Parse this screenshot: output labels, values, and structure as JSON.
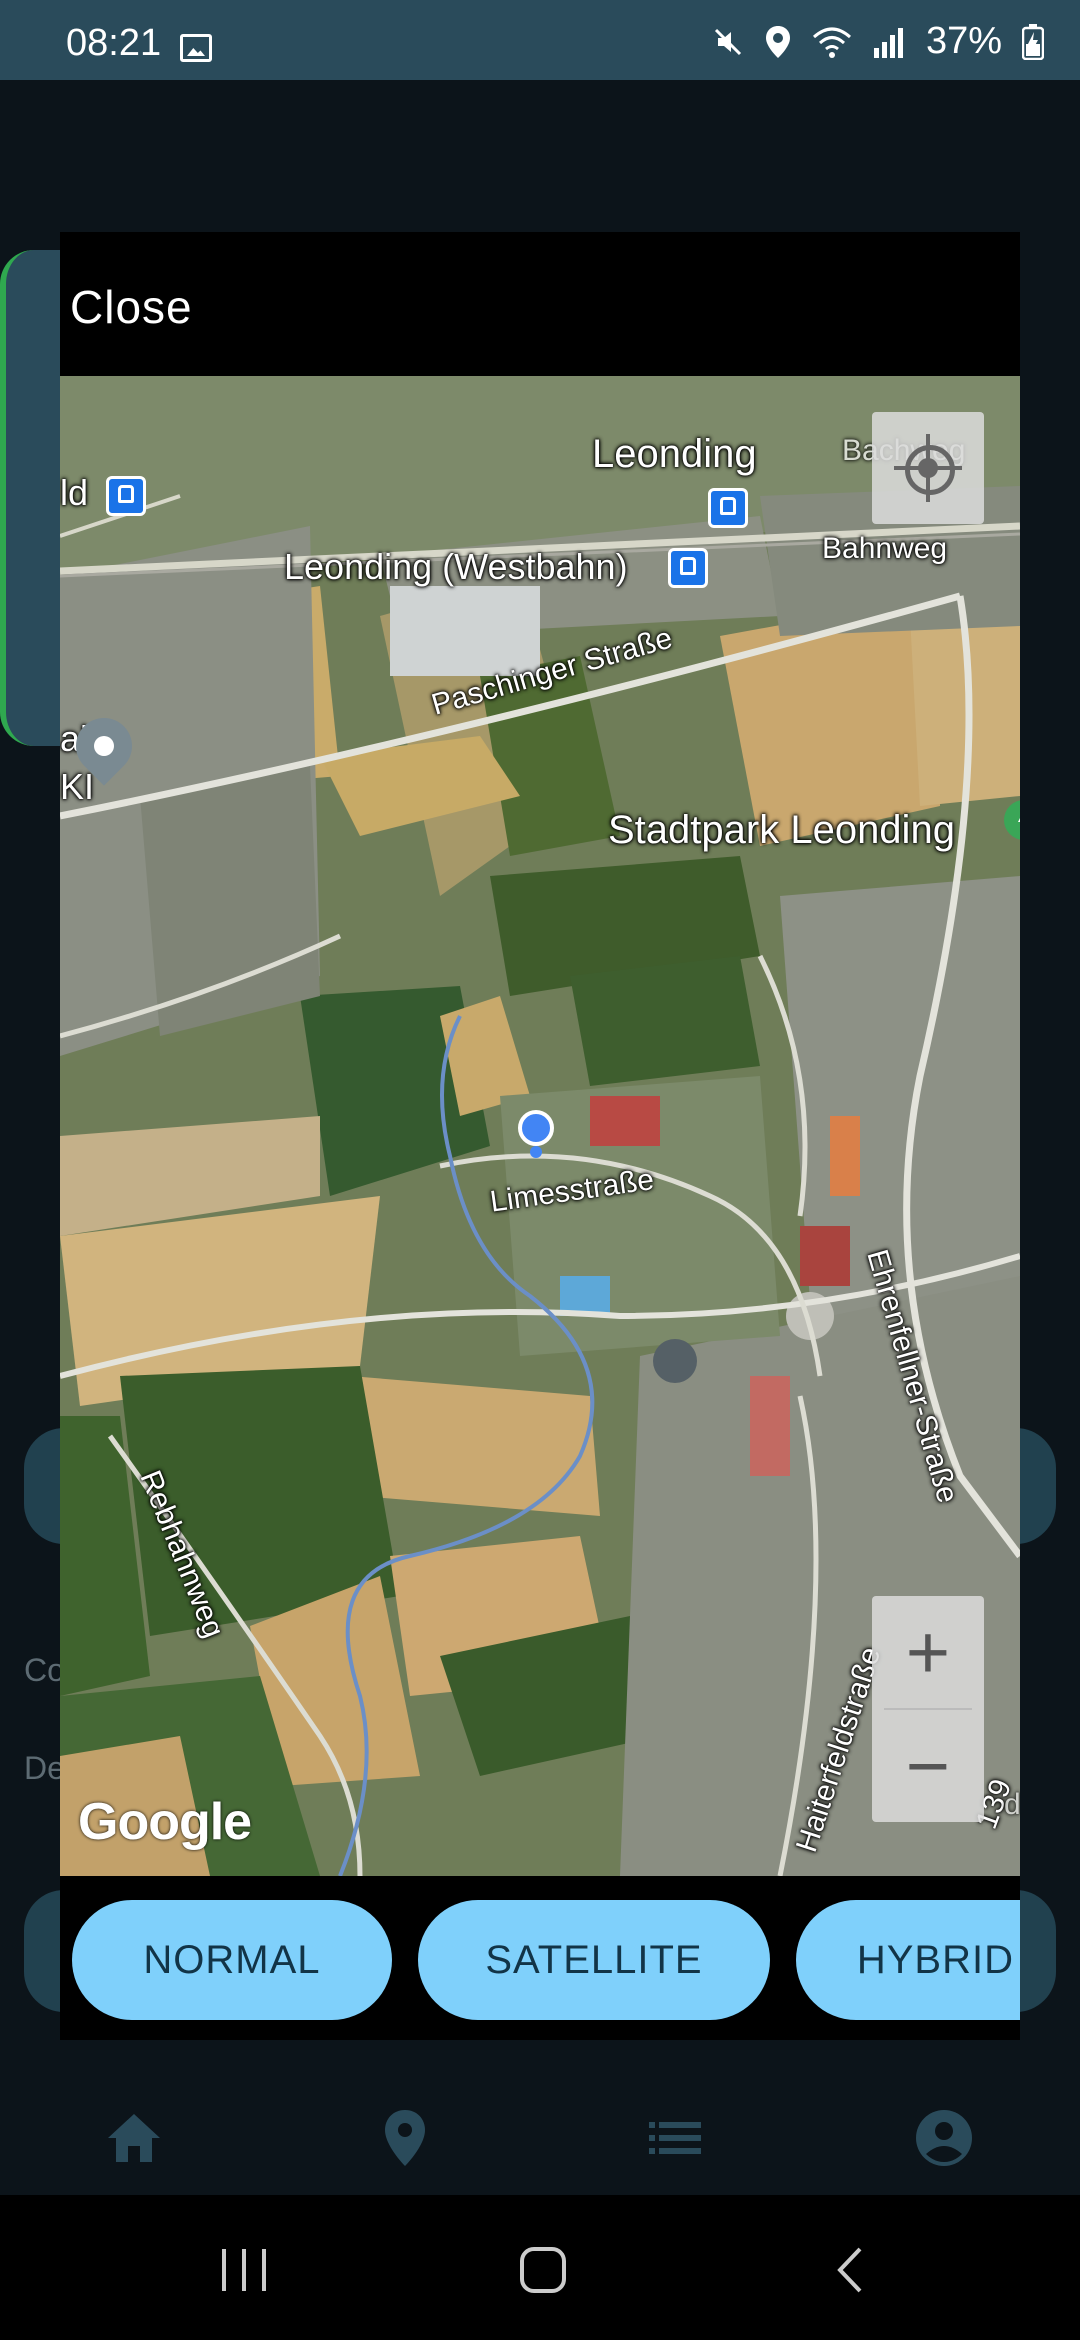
{
  "status_bar": {
    "time": "08:21",
    "battery": "37%",
    "icons": [
      "gallery-icon",
      "mute-icon",
      "location-icon",
      "wifi-icon",
      "signal-icon",
      "battery-icon"
    ]
  },
  "dialog": {
    "close_label": "Close"
  },
  "background": {
    "text_1": "Co",
    "text_2": "De"
  },
  "map": {
    "labels": {
      "leonding": "Leonding",
      "leonding_westbahn": "Leonding (Westbahn)",
      "bahnweg": "Bahnweg",
      "bachweg": "Bachweg",
      "paschinger": "Paschinger Straße",
      "stadtpark": "Stadtpark Leonding",
      "limesstrasse": "Limesstraße",
      "ehrenfellner": "Ehrenfellner-Straße",
      "rebhahnweg": "Rebhahnweg",
      "haiterfeld": "Haiterfeldstraße",
      "partial_ld": "ld",
      "partial_al": "al",
      "partial_kl": "KI",
      "route": "139",
      "partial_d": "d"
    },
    "logo": "Google",
    "zoom_in": "+",
    "zoom_out": "−"
  },
  "map_type_buttons": [
    "NORMAL",
    "SATELLITE",
    "HYBRID"
  ],
  "bottom_nav": [
    "home-icon",
    "location-pin-icon",
    "list-icon",
    "account-icon"
  ],
  "system_nav": [
    "recents-icon",
    "home-button-icon",
    "back-icon"
  ]
}
